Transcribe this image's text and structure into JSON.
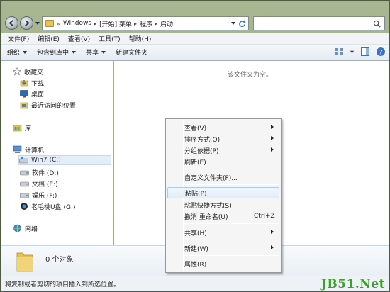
{
  "address": {
    "crumbs": [
      "Windows",
      "[开始] 菜单",
      "程序",
      "启动"
    ],
    "overflow": "«"
  },
  "menu": [
    "文件(F)",
    "编辑(E)",
    "查看(V)",
    "工具(T)",
    "帮助(H)"
  ],
  "toolbar": {
    "organize": "组织",
    "include_library": "包含到库中",
    "share": "共享",
    "new_folder": "新建文件夹"
  },
  "nav": {
    "favorites": "收藏夹",
    "downloads": "下载",
    "desktop": "桌面",
    "recent": "最近访问的位置",
    "libraries": "库",
    "computer": "计算机",
    "win7": "Win7 (C:)",
    "software": "软件 (D:)",
    "docs": "文档 (E:)",
    "entertainment": "娱乐 (F:)",
    "usb": "老毛桃U盘 (G:)",
    "network": "网络"
  },
  "content": {
    "empty": "该文件夹为空。"
  },
  "details": {
    "count": "0 个对象"
  },
  "status": "将复制或者剪切的项目插入到所选位置。",
  "context_menu": {
    "view": "查看(V)",
    "sort": "排序方式(O)",
    "group": "分组依据(P)",
    "refresh": "刷新(E)",
    "customize": "自定义文件夹(F)...",
    "paste": "粘贴(P)",
    "paste_shortcut": "粘贴快捷方式(S)",
    "undo": "撤消 重命名(U)",
    "undo_shortcut": "Ctrl+Z",
    "share": "共享(H)",
    "new": "新建(W)",
    "properties": "属性(R)"
  },
  "watermark": "JB51.Net"
}
